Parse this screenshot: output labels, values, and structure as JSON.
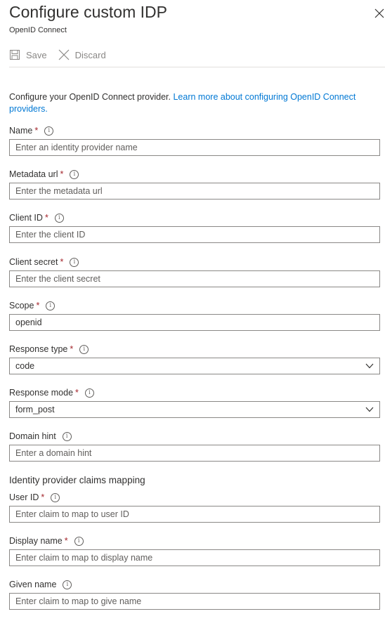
{
  "header": {
    "title": "Configure custom IDP",
    "subtitle": "OpenID Connect"
  },
  "toolbar": {
    "save_label": "Save",
    "discard_label": "Discard"
  },
  "intro": {
    "text": "Configure your OpenID Connect provider. ",
    "link": "Learn more about configuring OpenID Connect providers."
  },
  "fields": {
    "name": {
      "label": "Name",
      "placeholder": "Enter an identity provider name"
    },
    "metadata_url": {
      "label": "Metadata url",
      "placeholder": "Enter the metadata url"
    },
    "client_id": {
      "label": "Client ID",
      "placeholder": "Enter the client ID"
    },
    "client_secret": {
      "label": "Client secret",
      "placeholder": "Enter the client secret"
    },
    "scope": {
      "label": "Scope",
      "value": "openid"
    },
    "response_type": {
      "label": "Response type",
      "value": "code"
    },
    "response_mode": {
      "label": "Response mode",
      "value": "form_post"
    },
    "domain_hint": {
      "label": "Domain hint",
      "placeholder": "Enter a domain hint"
    }
  },
  "claims": {
    "heading": "Identity provider claims mapping",
    "user_id": {
      "label": "User ID",
      "placeholder": "Enter claim to map to user ID"
    },
    "display_name": {
      "label": "Display name",
      "placeholder": "Enter claim to map to display name"
    },
    "given_name": {
      "label": "Given name",
      "placeholder": "Enter claim to map to give name"
    }
  },
  "colors": {
    "link": "#0078d4",
    "required": "#a4262c",
    "border": "#8a8886"
  }
}
